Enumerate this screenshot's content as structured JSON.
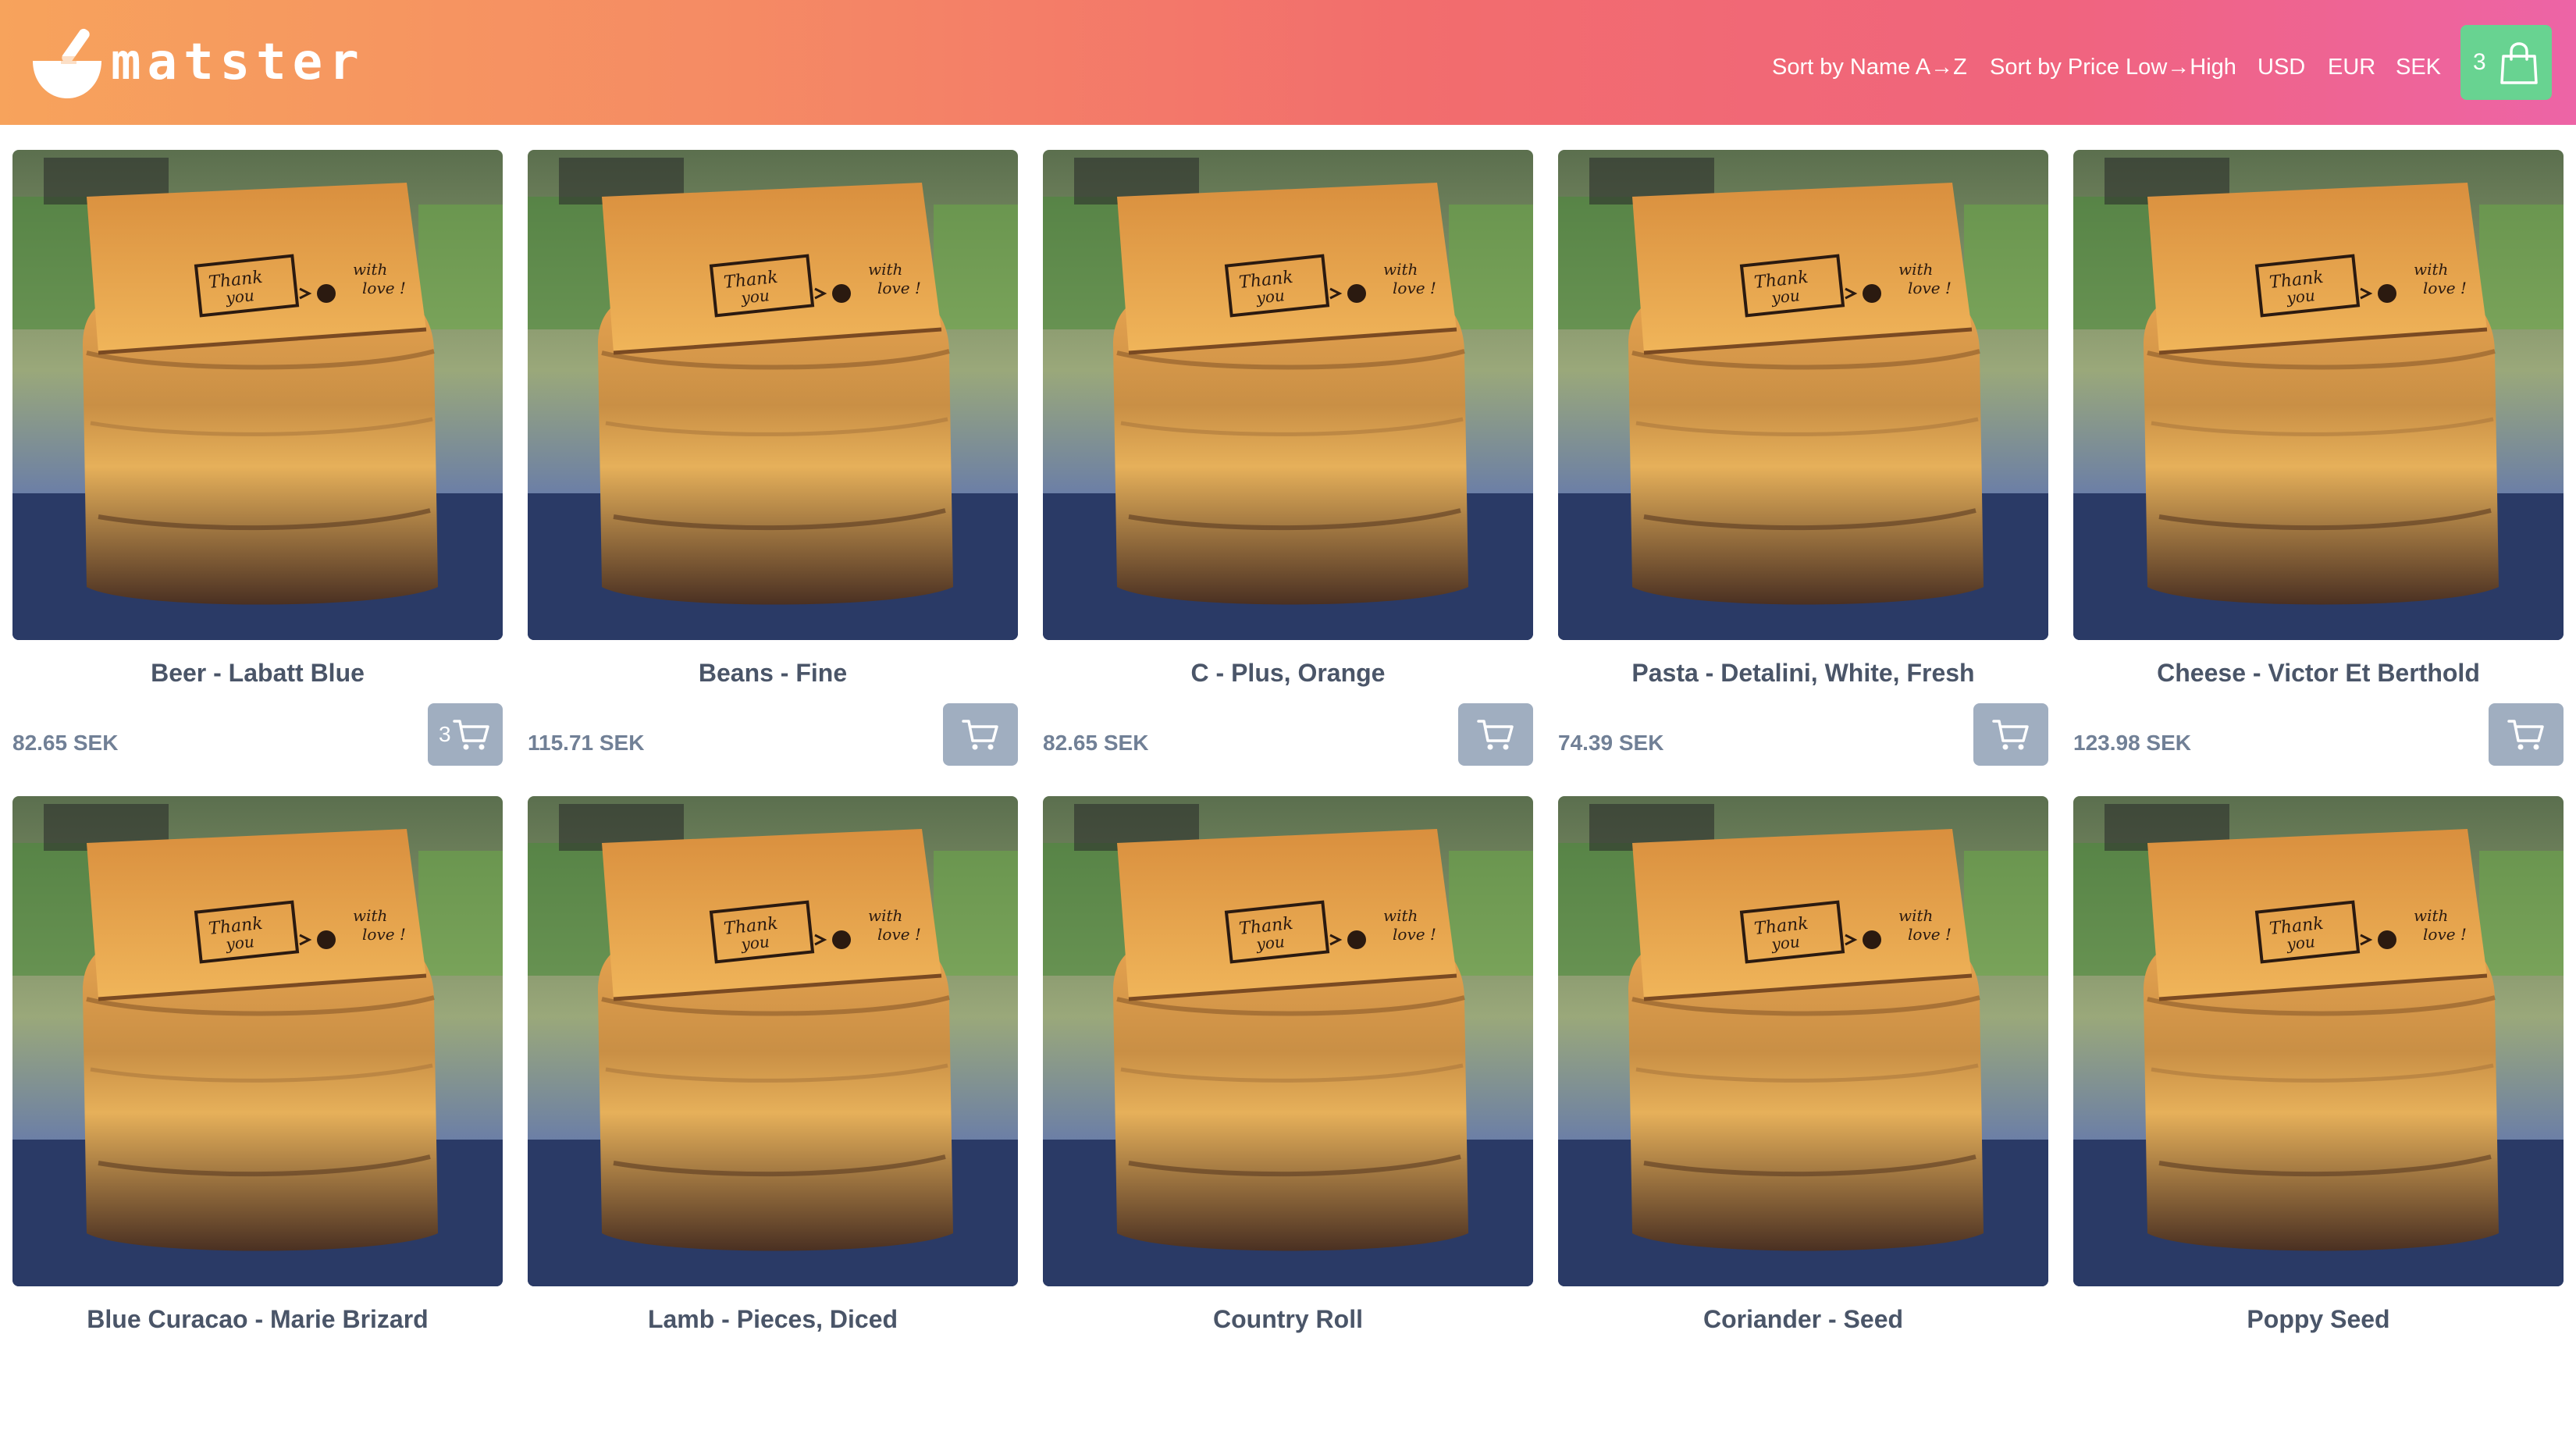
{
  "app": {
    "logo_text": "matster",
    "logo_icon": "bowl-icon"
  },
  "header": {
    "sort_links": [
      "Sort by Name A→Z",
      "Sort by Price Low→High"
    ],
    "currencies": [
      "USD",
      "EUR",
      "SEK"
    ],
    "cart": {
      "count": "3",
      "icon": "shopping-bag-icon"
    }
  },
  "products": [
    {
      "name": "Beer - Labatt Blue",
      "price": "82.65 SEK",
      "cart_qty": "3"
    },
    {
      "name": "Beans - Fine",
      "price": "115.71 SEK",
      "cart_qty": ""
    },
    {
      "name": "C - Plus, Orange",
      "price": "82.65 SEK",
      "cart_qty": ""
    },
    {
      "name": "Pasta - Detalini, White, Fresh",
      "price": "74.39 SEK",
      "cart_qty": ""
    },
    {
      "name": "Cheese - Victor Et Berthold",
      "price": "123.98 SEK",
      "cart_qty": ""
    },
    {
      "name": "Blue Curacao - Marie Brizard",
      "price": "",
      "cart_qty": ""
    },
    {
      "name": "Lamb - Pieces, Diced",
      "price": "",
      "cart_qty": ""
    },
    {
      "name": "Country Roll",
      "price": "",
      "cart_qty": ""
    },
    {
      "name": "Coriander - Seed",
      "price": "",
      "cart_qty": ""
    },
    {
      "name": "Poppy Seed",
      "price": "",
      "cart_qty": ""
    }
  ],
  "product_image": {
    "note_text": [
      "Thank",
      "you",
      "with",
      "love !"
    ]
  },
  "colors": {
    "cart_button": "#68d391",
    "add_button": "#a0aec0",
    "text": "#4a5568",
    "price": "#718096"
  }
}
